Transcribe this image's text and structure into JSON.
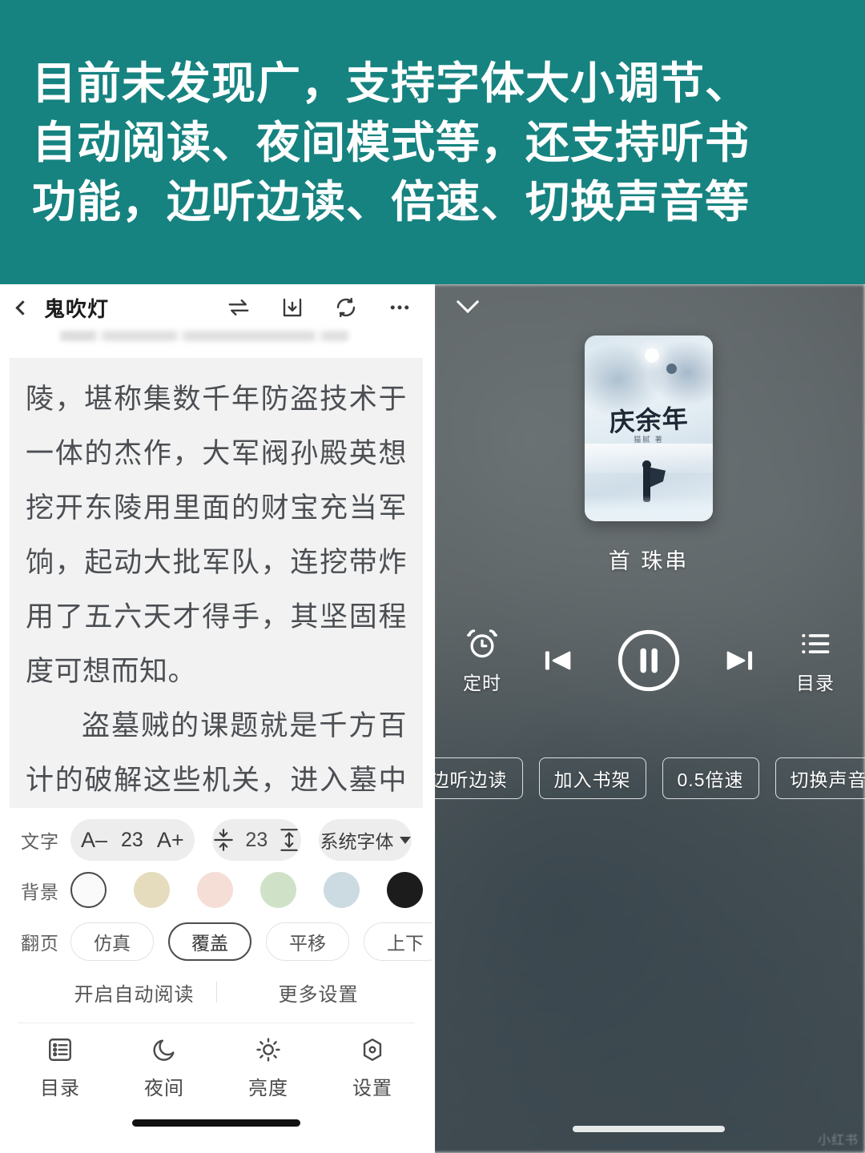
{
  "banner": {
    "background_color": "#168380",
    "text_color": "#ffffff",
    "lines": [
      "目前未发现广，支持字体大小调节、",
      "自动阅读、夜间模式等，还支持听书",
      "功能，边听边读、倍速、切换声音等"
    ]
  },
  "reader": {
    "topbar": {
      "back_icon": "back-chevron-icon",
      "title": "鬼吹灯",
      "icons": [
        "swap-arrows-icon",
        "download-tray-icon",
        "refresh-sync-icon",
        "more-dots-icon"
      ]
    },
    "urlbar": {
      "value": "",
      "blurred": true
    },
    "content": {
      "paragraphs": [
        "陵，堪称集数千年防盗技术于一体的杰作，大军阀孙殿英想挖开东陵用里面的财宝充当军饷，起动大批军队，连挖带炸用了五六天才得手，其坚固程度可想而知。",
        "盗墓贼的课题就是千方百计的破解这些机关，进入墓中探宝。不过在现代，比起如何挖开古墓更困难"
      ],
      "background_color": "#f2f2f2",
      "text_color": "#4b4f53"
    },
    "settings": {
      "text_label": "文字",
      "font_decrease": "A–",
      "font_size_value": "23",
      "font_increase": "A+",
      "line_spacing_value": "23",
      "line_spacing_decrease_icon": "line-spacing-decrease-icon",
      "line_spacing_increase_icon": "line-spacing-increase-icon",
      "font_family_label": "系统字体",
      "font_family_caret": "chevron-down-icon",
      "background_label": "背景",
      "background_swatches": [
        {
          "name": "white",
          "color": "#fafafa",
          "selected": true
        },
        {
          "name": "beige",
          "color": "#e5dcbd",
          "selected": false
        },
        {
          "name": "pink",
          "color": "#f5ded5",
          "selected": false
        },
        {
          "name": "green",
          "color": "#cfe2c8",
          "selected": false
        },
        {
          "name": "blue-gray",
          "color": "#ccdbe2",
          "selected": false
        },
        {
          "name": "black",
          "color": "#1c1c1c",
          "selected": false
        }
      ],
      "page_turn_label": "翻页",
      "page_turn_options": [
        {
          "label": "仿真",
          "selected": false
        },
        {
          "label": "覆盖",
          "selected": true
        },
        {
          "label": "平移",
          "selected": false
        },
        {
          "label": "上下",
          "selected": false
        }
      ],
      "auto_read_label": "开启自动阅读",
      "more_settings_label": "更多设置"
    },
    "tabbar": [
      {
        "label": "目录",
        "icon": "list-catalog-icon"
      },
      {
        "label": "夜间",
        "icon": "moon-icon"
      },
      {
        "label": "亮度",
        "icon": "sun-brightness-icon"
      },
      {
        "label": "设置",
        "icon": "gear-settings-icon"
      }
    ]
  },
  "player": {
    "collapse_icon": "chevron-down-icon",
    "cover": {
      "title": "庆余年",
      "subtitle": "猫腻 著"
    },
    "track_name": "首 珠串",
    "controls": [
      {
        "name": "timer",
        "label": "定时",
        "icon": "alarm-clock-icon"
      },
      {
        "name": "previous",
        "label": "",
        "icon": "previous-track-icon"
      },
      {
        "name": "play-pause",
        "label": "",
        "icon": "pause-circle-icon"
      },
      {
        "name": "next",
        "label": "",
        "icon": "next-track-icon"
      },
      {
        "name": "catalog",
        "label": "目录",
        "icon": "list-catalog-icon"
      }
    ],
    "chips": [
      "边听边读",
      "加入书架",
      "0.5倍速",
      "切换声音"
    ],
    "watermark": "小红书",
    "background_color": "#4f5558"
  }
}
